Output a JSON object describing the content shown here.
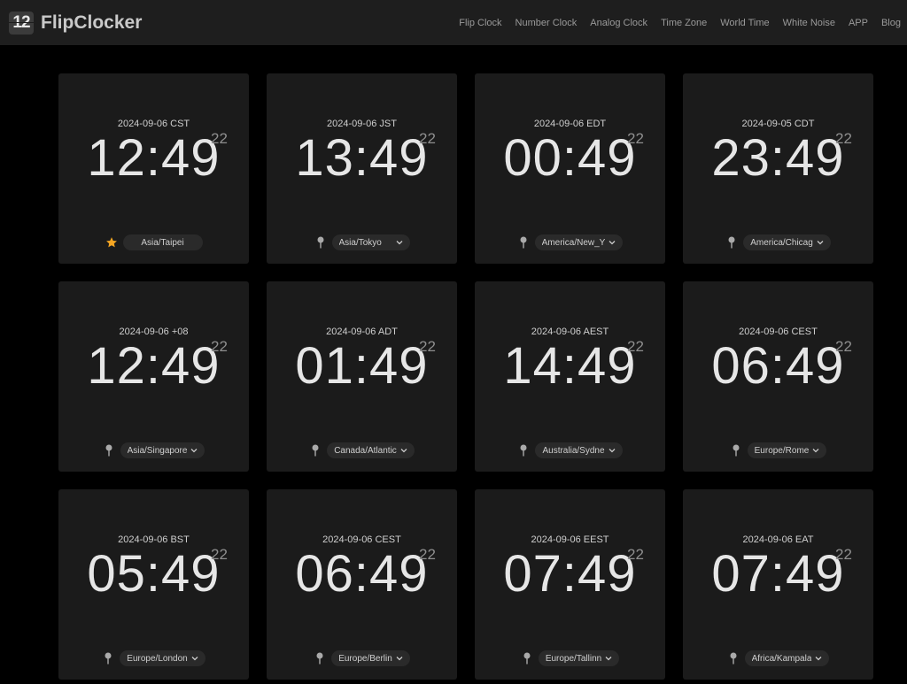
{
  "brand": {
    "logo_text": "12",
    "name": "FlipClocker"
  },
  "nav": [
    "Flip Clock",
    "Number Clock",
    "Analog Clock",
    "Time Zone",
    "World Time",
    "White Noise",
    "APP",
    "Blog"
  ],
  "colors": {
    "star": "#f5a623",
    "card": "#1b1b1b",
    "topbar": "#1e1e1e"
  },
  "clocks": [
    {
      "date": "2024-09-06 CST",
      "time": "12:49",
      "seconds": "22",
      "zone": "Asia/Taipei",
      "icon": "star-icon",
      "dropdown": false
    },
    {
      "date": "2024-09-06 JST",
      "time": "13:49",
      "seconds": "22",
      "zone": "Asia/Tokyo",
      "icon": "pin-icon",
      "dropdown": true
    },
    {
      "date": "2024-09-06 EDT",
      "time": "00:49",
      "seconds": "22",
      "zone": "America/New_Y",
      "icon": "pin-icon",
      "dropdown": true
    },
    {
      "date": "2024-09-05 CDT",
      "time": "23:49",
      "seconds": "22",
      "zone": "America/Chicag",
      "icon": "pin-icon",
      "dropdown": true
    },
    {
      "date": "2024-09-06 +08",
      "time": "12:49",
      "seconds": "22",
      "zone": "Asia/Singapore",
      "icon": "pin-icon",
      "dropdown": true
    },
    {
      "date": "2024-09-06 ADT",
      "time": "01:49",
      "seconds": "22",
      "zone": "Canada/Atlantic",
      "icon": "pin-icon",
      "dropdown": true
    },
    {
      "date": "2024-09-06 AEST",
      "time": "14:49",
      "seconds": "22",
      "zone": "Australia/Sydne",
      "icon": "pin-icon",
      "dropdown": true
    },
    {
      "date": "2024-09-06 CEST",
      "time": "06:49",
      "seconds": "22",
      "zone": "Europe/Rome",
      "icon": "pin-icon",
      "dropdown": true
    },
    {
      "date": "2024-09-06 BST",
      "time": "05:49",
      "seconds": "22",
      "zone": "Europe/London",
      "icon": "pin-icon",
      "dropdown": true
    },
    {
      "date": "2024-09-06 CEST",
      "time": "06:49",
      "seconds": "22",
      "zone": "Europe/Berlin",
      "icon": "pin-icon",
      "dropdown": true
    },
    {
      "date": "2024-09-06 EEST",
      "time": "07:49",
      "seconds": "22",
      "zone": "Europe/Tallinn",
      "icon": "pin-icon",
      "dropdown": true
    },
    {
      "date": "2024-09-06 EAT",
      "time": "07:49",
      "seconds": "22",
      "zone": "Africa/Kampala",
      "icon": "pin-icon",
      "dropdown": true
    }
  ]
}
